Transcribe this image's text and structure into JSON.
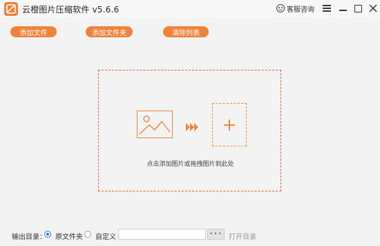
{
  "window": {
    "title": "云橙图片压缩软件 v5.6.6",
    "support_label": "客服咨询",
    "accent_color": "#f08239"
  },
  "toolbar": {
    "add_file": "添加文件",
    "add_folder": "添加文件夹",
    "clear_list": "清除列表"
  },
  "dropzone": {
    "hint": "点击添加图片或拖拽图片到此处"
  },
  "output": {
    "label": "输出目录：",
    "option_original": "原文件夹",
    "option_custom": "自定义",
    "selected": "原文件夹",
    "path_value": "",
    "path_placeholder": "",
    "browse_label": "•••",
    "open_dir": "打开目录"
  }
}
